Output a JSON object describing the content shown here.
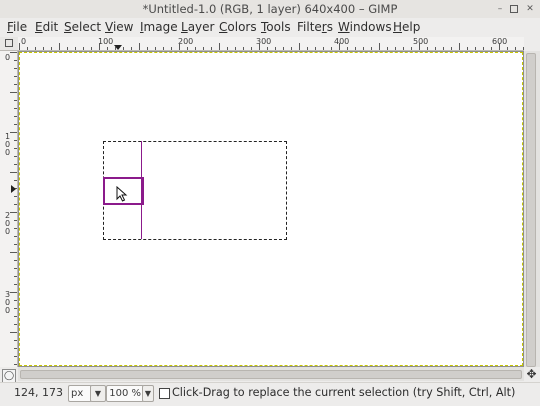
{
  "window": {
    "title": "*Untitled-1.0 (RGB, 1 layer) 640x400 – GIMP",
    "controls": [
      "minimize-icon",
      "maximize-icon",
      "close-icon"
    ]
  },
  "menubar": {
    "items": [
      {
        "label": "File",
        "key": "F"
      },
      {
        "label": "Edit",
        "key": "E"
      },
      {
        "label": "Select",
        "key": "S"
      },
      {
        "label": "View",
        "key": "V"
      },
      {
        "label": "Image",
        "key": "I"
      },
      {
        "label": "Layer",
        "key": "L"
      },
      {
        "label": "Colors",
        "key": "C"
      },
      {
        "label": "Tools",
        "key": "T"
      },
      {
        "label": "Filters",
        "key": "r"
      },
      {
        "label": "Windows",
        "key": "W"
      },
      {
        "label": "Help",
        "key": "H"
      }
    ]
  },
  "rulers": {
    "horizontal_labels": [
      "0",
      "100",
      "200",
      "300",
      "400",
      "500",
      "600"
    ],
    "vertical_labels": [
      "0",
      "100",
      "200",
      "300"
    ]
  },
  "canvas": {
    "icons": [
      "pointer-cursor-icon",
      "navigate-icon",
      "zoom-toggle-icon"
    ]
  },
  "statusbar": {
    "coordinates": "124, 173",
    "unit": "px",
    "zoom": "100 %",
    "message": "Click-Drag to replace the current selection (try Shift, Ctrl, Alt)"
  },
  "colors": {
    "selection_guide": "#8b1a8b",
    "canvas_border": "#c6c600",
    "background": "#edeceb"
  }
}
